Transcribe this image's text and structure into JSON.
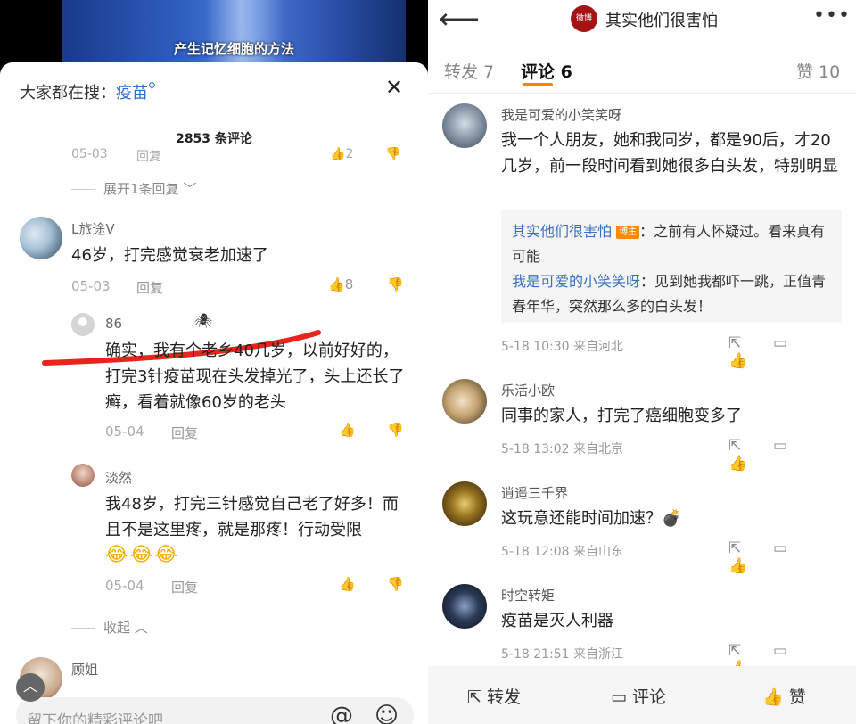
{
  "left": {
    "video_caption": "产生记忆细胞的方法",
    "search": {
      "prefix": "大家都在搜：",
      "keyword": "疫苗",
      "close_icon": "close-icon"
    },
    "comment_count": "2853 条评论",
    "ghost_row": {
      "date": "05-03",
      "reply": "回复",
      "likes": "2"
    },
    "expand_label": "展开1条回复",
    "main_comment": {
      "user": "L旅途V",
      "text": "46岁，打完感觉衰老加速了",
      "date": "05-03",
      "reply": "回复",
      "likes": "8"
    },
    "replies": [
      {
        "user": "86",
        "text": "确实，我有个老乡40几岁，以前好好的，打完3针疫苗现在头发掉光了，头上还长了癣，看着就像60岁的老头",
        "date": "05-04",
        "reply": "回复"
      },
      {
        "user": "淡然",
        "text": "我48岁，打完三针感觉自己老了好多！而且不是这里疼，就是那疼！行动受限",
        "date": "05-04",
        "reply": "回复"
      }
    ],
    "collapse_label": "收起",
    "next_user": "顾姐",
    "input_placeholder": "留下你的精彩评论吧",
    "annotation_color": "#e8241c"
  },
  "right": {
    "title": "其实他们很害怕",
    "logo_text": "微博",
    "tabs": [
      {
        "label": "转发 7"
      },
      {
        "label": "评论 6"
      },
      {
        "label": "赞 10"
      }
    ],
    "comments": [
      {
        "user": "我是可爱的小笑笑呀",
        "text": "我一个人朋友，她和我同岁，都是90后，才20几岁，前一段时间看到她很多白头发，特别明显",
        "meta": "5-18 10:30 来自河北",
        "replies": [
          {
            "user": "其实他们很害怕",
            "badge": "博主",
            "text": "：之前有人怀疑过。看来真有可能"
          },
          {
            "user": "我是可爱的小笑笑呀",
            "text": "：见到她我都吓一跳，正值青春年华，突然那么多的白头发！"
          }
        ]
      },
      {
        "user": "乐活小欧",
        "text": "同事的家人，打完了癌细胞变多了",
        "meta": "5-18 13:02 来自北京"
      },
      {
        "user": "逍遥三千界",
        "text": "这玩意还能时间加速？💣",
        "meta": "5-18 12:08 来自山东"
      },
      {
        "user": "时空转矩",
        "text": "疫苗是灭人利器",
        "meta": "5-18 21:51 来自浙江"
      }
    ],
    "bottom": {
      "repost": "转发",
      "comment": "评论",
      "like": "赞"
    },
    "accent": "#ff8200"
  }
}
